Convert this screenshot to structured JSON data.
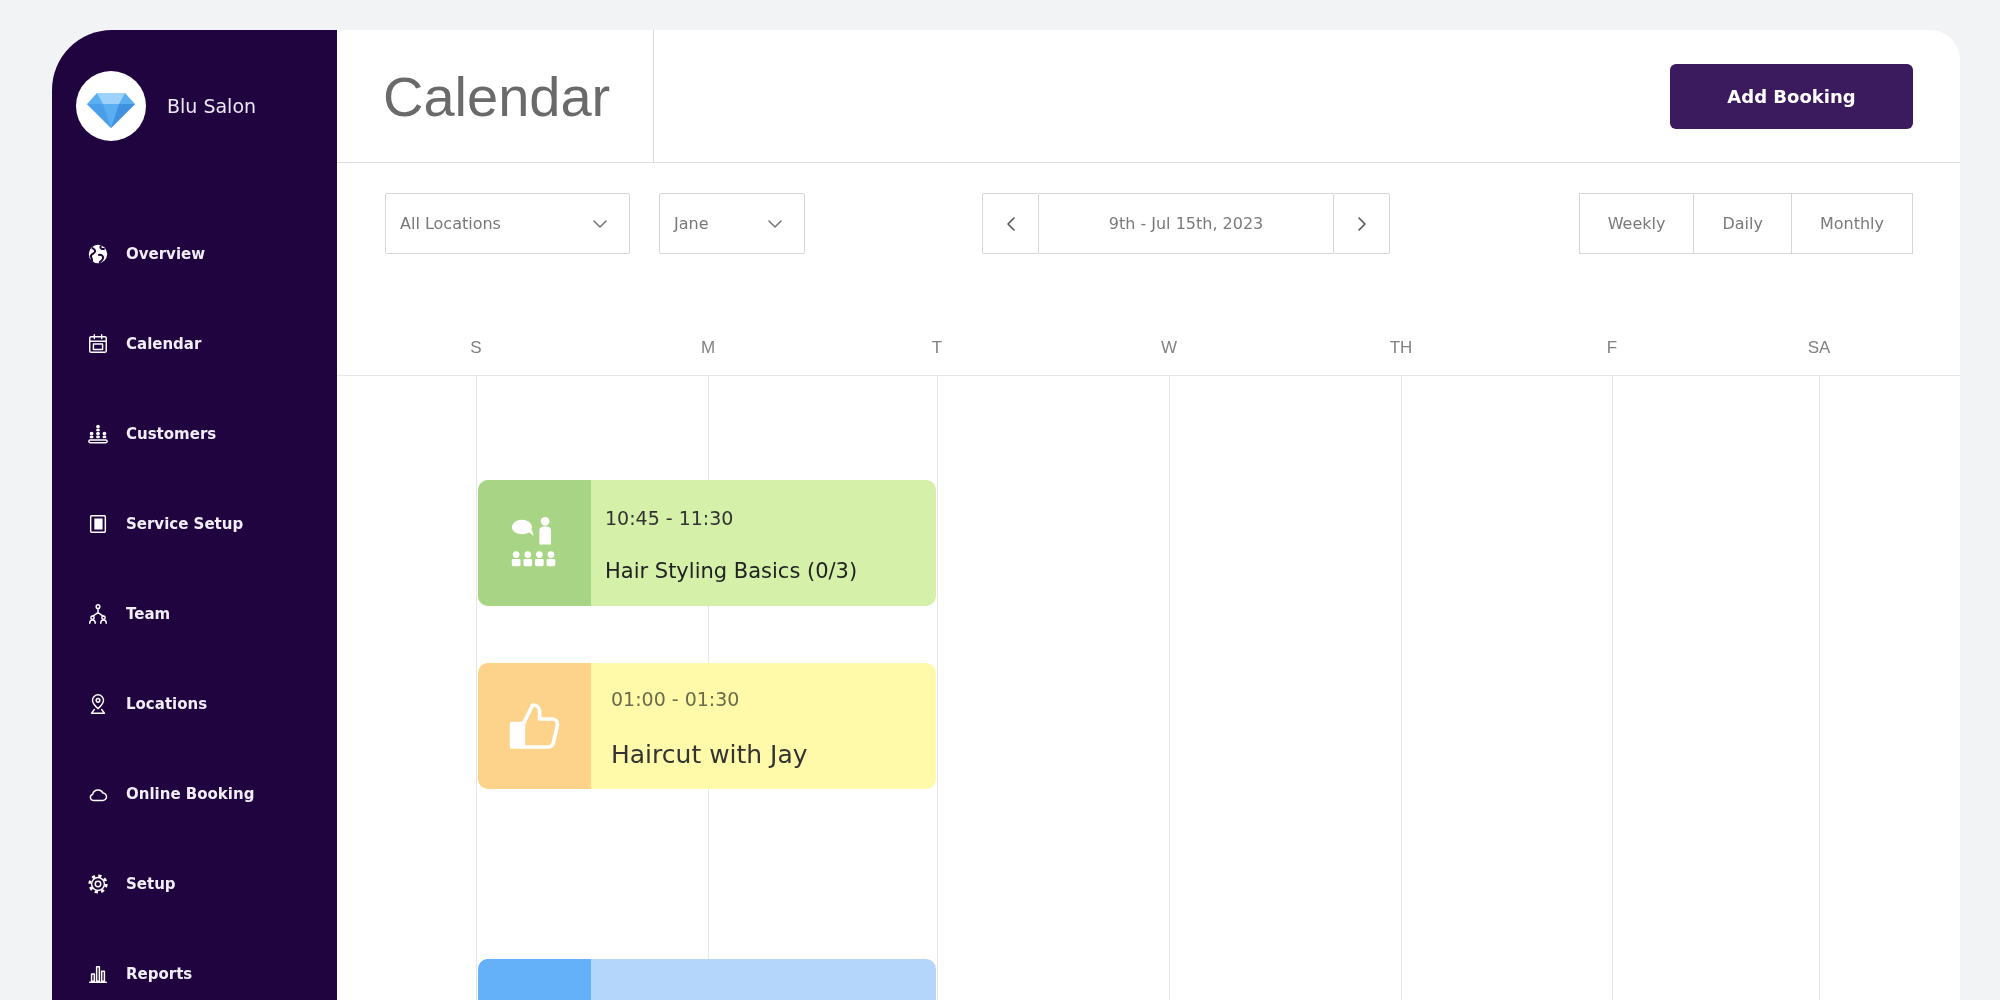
{
  "sidebar": {
    "brand": "Blu Salon",
    "nav": [
      {
        "label": "Overview"
      },
      {
        "label": "Calendar"
      },
      {
        "label": "Customers"
      },
      {
        "label": "Service Setup"
      },
      {
        "label": "Team"
      },
      {
        "label": "Locations"
      },
      {
        "label": "Online Booking"
      },
      {
        "label": "Setup"
      },
      {
        "label": "Reports"
      }
    ]
  },
  "header": {
    "title": "Calendar",
    "add_button": "Add Booking"
  },
  "toolbar": {
    "filters": [
      {
        "value": "All Locations"
      },
      {
        "value": "Jane"
      }
    ],
    "date_range": "9th - Jul 15th, 2023",
    "views": [
      "Weekly",
      "Daily",
      "Monthly"
    ]
  },
  "calendar": {
    "days": [
      "S",
      "M",
      "T",
      "W",
      "TH",
      "F",
      "SA"
    ],
    "events": [
      {
        "kind": "class",
        "time": "10:45 - 11:30",
        "title": "Hair Styling Basics (0/3)",
        "color": "#d4f0a9",
        "tile": {
          "color": "#a8d585"
        }
      },
      {
        "kind": "appointment",
        "time": "01:00 - 01:30",
        "title": "Haircut with Jay",
        "color": "#fefaa9",
        "tile": {
          "color": "#fdd38b"
        }
      },
      {
        "color": "#b4d6fb",
        "tile": {
          "color": "#64b0f9"
        }
      }
    ]
  }
}
